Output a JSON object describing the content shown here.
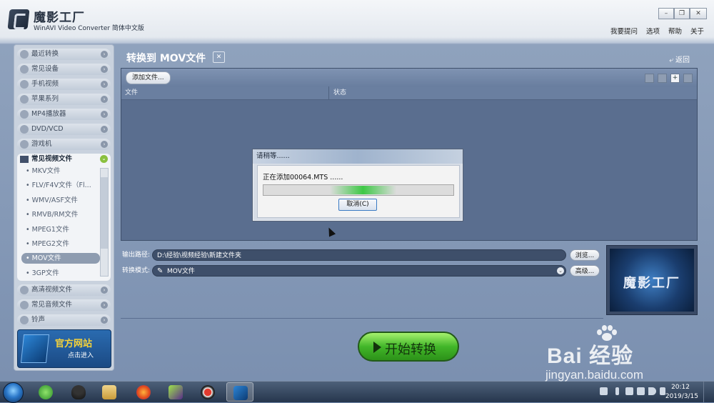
{
  "window": {
    "app_title": "魔影工厂",
    "subtitle": "WinAVI Video Converter 简体中文版",
    "menu": [
      "我要提问",
      "选项",
      "帮助",
      "关于"
    ]
  },
  "sidebar": {
    "items_top": [
      "最近转换",
      "常见设备",
      "手机视频",
      "苹果系列",
      "MP4播放器",
      "DVD/VCD",
      "游戏机"
    ],
    "open_group": "常见视频文件",
    "sub_items": [
      "MKV文件",
      "FLV/F4V文件（Fl...",
      "WMV/ASF文件",
      "RMVB/RM文件",
      "MPEG1文件",
      "MPEG2文件",
      "MOV文件",
      "3GP文件"
    ],
    "selected_sub": "MOV文件",
    "items_bottom": [
      "高清视频文件",
      "常见音频文件",
      "铃声"
    ],
    "ad_title": "官方网站",
    "ad_sub": "点击进入"
  },
  "main": {
    "title": "转换到 MOV文件",
    "back": "返回",
    "add_file": "添加文件...",
    "col_file": "文件",
    "col_status": "状态",
    "output_label": "输出路径:",
    "output_path": "D:\\经验\\视频经验\\新建文件夹",
    "browse": "浏览...",
    "mode_label": "转换模式:",
    "mode_value": "MOV文件",
    "advanced": "高级...",
    "preview_text": "魔影工厂",
    "start": "开始转换"
  },
  "dialog": {
    "title": "请稍等......",
    "message": "正在添加00064.MTS ......",
    "cancel": "取消(C)",
    "progress_pct": 35
  },
  "watermark": {
    "brand": "Bai 经验",
    "url": "jingyan.baidu.com"
  },
  "taskbar": {
    "time": "20:12",
    "date": "2019/3/15"
  }
}
